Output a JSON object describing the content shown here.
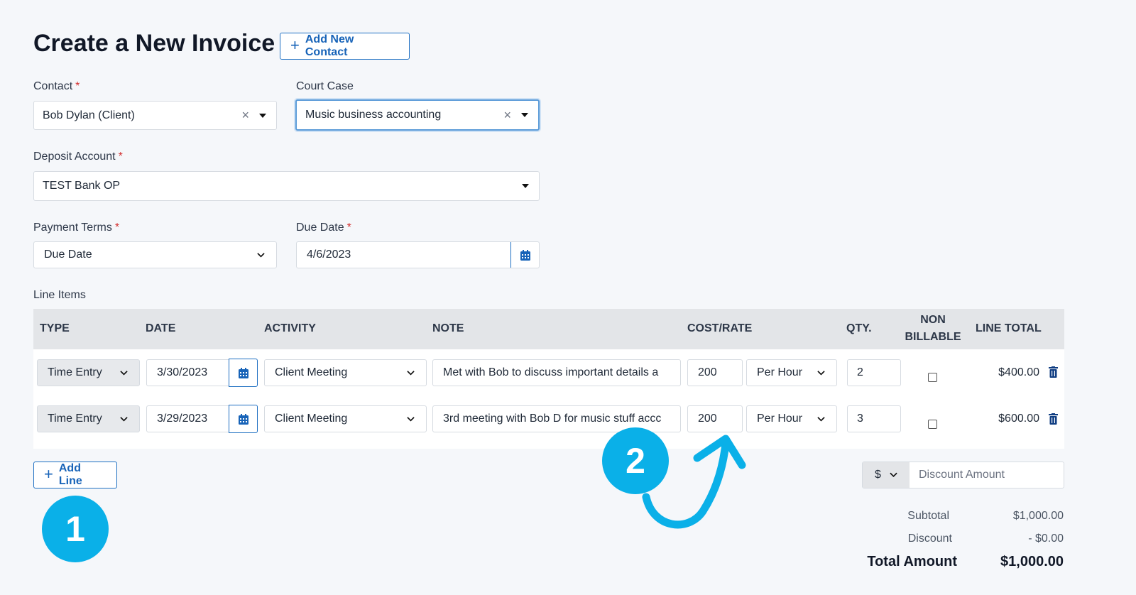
{
  "header": {
    "title": "Create a New Invoice",
    "add_contact_label": "Add New Contact"
  },
  "form": {
    "contact": {
      "label": "Contact",
      "value": "Bob Dylan (Client)"
    },
    "court_case": {
      "label": "Court Case",
      "value": "Music business accounting"
    },
    "deposit_account": {
      "label": "Deposit Account",
      "value": "TEST Bank OP"
    },
    "payment_terms": {
      "label": "Payment Terms",
      "value": "Due Date"
    },
    "due_date": {
      "label": "Due Date",
      "value": "4/6/2023"
    },
    "required_mark": "*"
  },
  "line_items": {
    "label": "Line Items",
    "headers": {
      "type": "TYPE",
      "date": "DATE",
      "activity": "ACTIVITY",
      "note": "NOTE",
      "cost_rate": "COST/RATE",
      "qty": "QTY.",
      "non_billable_1": "NON",
      "non_billable_2": "BILLABLE",
      "line_total": "LINE TOTAL"
    },
    "rows": [
      {
        "type": "Time Entry",
        "date": "3/30/2023",
        "activity": "Client Meeting",
        "note": "Met with Bob to discuss important details a",
        "rate": "200",
        "unit": "Per Hour",
        "qty": "2",
        "total": "$400.00"
      },
      {
        "type": "Time Entry",
        "date": "3/29/2023",
        "activity": "Client Meeting",
        "note": "3rd meeting with Bob D for music stuff accc",
        "rate": "200",
        "unit": "Per Hour",
        "qty": "3",
        "total": "$600.00"
      }
    ],
    "add_line_label": "Add Line"
  },
  "discount": {
    "currency": "$",
    "placeholder": "Discount Amount"
  },
  "summary": {
    "subtotal_label": "Subtotal",
    "subtotal_value": "$1,000.00",
    "discount_label": "Discount",
    "discount_value": "- $0.00",
    "total_label": "Total Amount",
    "total_value": "$1,000.00"
  },
  "annotations": {
    "badge_1": "1",
    "badge_2": "2",
    "accent_color": "#0ab0e8"
  }
}
